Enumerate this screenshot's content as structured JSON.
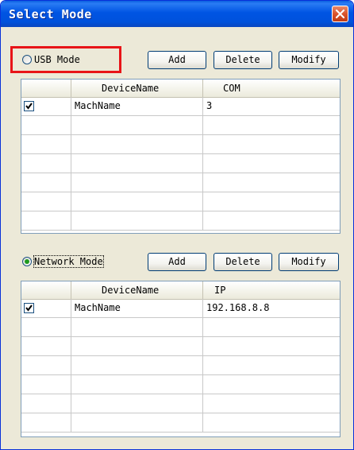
{
  "window": {
    "title": "Select Mode"
  },
  "usb": {
    "mode_label": "USB Mode",
    "selected": false,
    "buttons": {
      "add": "Add",
      "delete": "Delete",
      "modify": "Modify"
    },
    "columns": [
      "DeviceName",
      "COM"
    ],
    "rows": [
      {
        "checked": true,
        "device": "MachName",
        "value": "3"
      }
    ]
  },
  "network": {
    "mode_label": "Network Mode",
    "selected": true,
    "buttons": {
      "add": "Add",
      "delete": "Delete",
      "modify": "Modify"
    },
    "columns": [
      "DeviceName",
      "IP"
    ],
    "rows": [
      {
        "checked": true,
        "device": "MachName",
        "value": "192.168.8.8"
      }
    ]
  },
  "colors": {
    "title_bar": "#0054e3",
    "highlight": "#e81418",
    "radio_selected": "#1f9a1f"
  }
}
